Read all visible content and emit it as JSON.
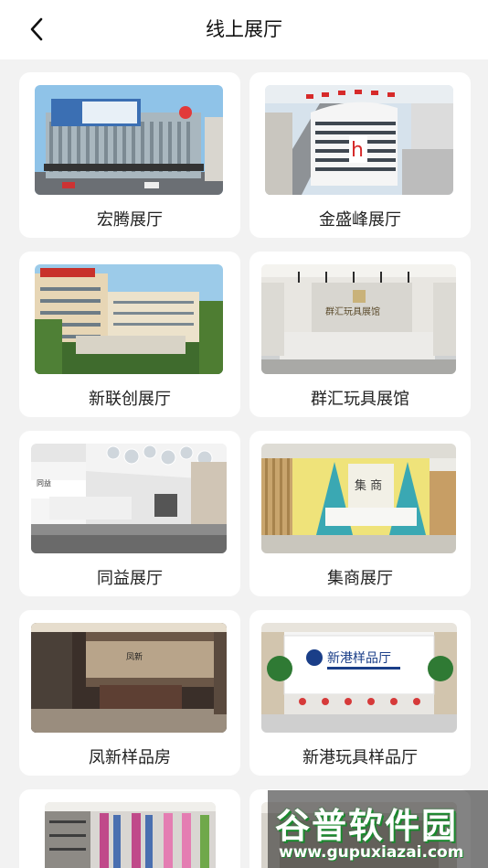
{
  "header": {
    "title": "线上展厅",
    "back_icon": "chevron-left-icon"
  },
  "halls": [
    {
      "name": "宏腾展厅"
    },
    {
      "name": "金盛峰展厅"
    },
    {
      "name": "新联创展厅"
    },
    {
      "name": "群汇玩具展馆"
    },
    {
      "name": "同益展厅"
    },
    {
      "name": "集商展厅"
    },
    {
      "name": "凤新样品房"
    },
    {
      "name": "新港玩具样品厅"
    }
  ],
  "watermark": {
    "title": "谷普软件园",
    "url": "www.gupuxiazai.com"
  },
  "colors": {
    "background": "#f2f2f2",
    "card": "#ffffff",
    "watermark_green": "#1a8a2e"
  }
}
